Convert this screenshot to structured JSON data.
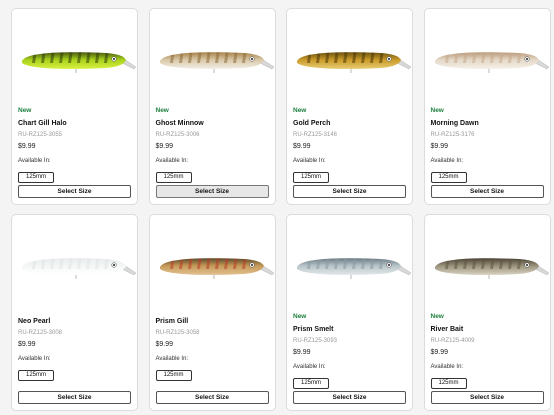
{
  "products": [
    {
      "badge": "New",
      "name": "Chart Gill Halo",
      "sku": "RU-RZ125-3055",
      "price": "$9.99",
      "available_label": "Available In:",
      "size": "125mm",
      "button": "Select Size",
      "colors": {
        "back": "#4a5a10",
        "mid": "#a8d21c",
        "belly": "#d8f040",
        "bar": "#2f3a08"
      }
    },
    {
      "badge": "New",
      "name": "Ghost Minnow",
      "sku": "RU-RZ125-3006",
      "price": "$9.99",
      "available_label": "Available In:",
      "size": "125mm",
      "button": "Select Size",
      "colors": {
        "back": "#a8844c",
        "mid": "#d9c7a6",
        "belly": "#f2efe8",
        "bar": "#8d6a38"
      }
    },
    {
      "badge": "New",
      "name": "Gold Perch",
      "sku": "RU-RZ125-3146",
      "price": "$9.99",
      "available_label": "Available In:",
      "size": "125mm",
      "button": "Select Size",
      "colors": {
        "back": "#6e5410",
        "mid": "#c99a2a",
        "belly": "#e8cc70",
        "bar": "#4a3608"
      }
    },
    {
      "badge": "New",
      "name": "Morning Dawn",
      "sku": "RU-RZ125-3176",
      "price": "$9.99",
      "available_label": "Available In:",
      "size": "125mm",
      "button": "Select Size",
      "colors": {
        "back": "#b99b7a",
        "mid": "#e4d8c8",
        "belly": "#f5f0e8",
        "bar": "#c7a98a"
      }
    },
    {
      "badge": "",
      "name": "Neo Pearl",
      "sku": "RU-RZ125-3008",
      "price": "$9.99",
      "available_label": "Available In:",
      "size": "125mm",
      "button": "Select Size",
      "colors": {
        "back": "#e8ecec",
        "mid": "#f4f6f6",
        "belly": "#ffffff",
        "bar": "#e0e4e4"
      }
    },
    {
      "badge": "",
      "name": "Prism Gill",
      "sku": "RU-RZ125-3058",
      "price": "$9.99",
      "available_label": "Available In:",
      "size": "125mm",
      "button": "Select Size",
      "colors": {
        "back": "#5a4a2a",
        "mid": "#c49a58",
        "belly": "#e2c090",
        "bar": "#b83a2a"
      }
    },
    {
      "badge": "New",
      "name": "Prism Smelt",
      "sku": "RU-RZ125-3093",
      "price": "$9.99",
      "available_label": "Available In:",
      "size": "125mm",
      "button": "Select Size",
      "colors": {
        "back": "#6a7a84",
        "mid": "#b8c4c8",
        "belly": "#e2e8ea",
        "bar": "#8a9aa2"
      }
    },
    {
      "badge": "New",
      "name": "River Bait",
      "sku": "RU-RZ125-4009",
      "price": "$9.99",
      "available_label": "Available In:",
      "size": "125mm",
      "button": "Select Size",
      "colors": {
        "back": "#4a4434",
        "mid": "#9a927a",
        "belly": "#d8d2c2",
        "bar": "#5e5644"
      }
    }
  ]
}
